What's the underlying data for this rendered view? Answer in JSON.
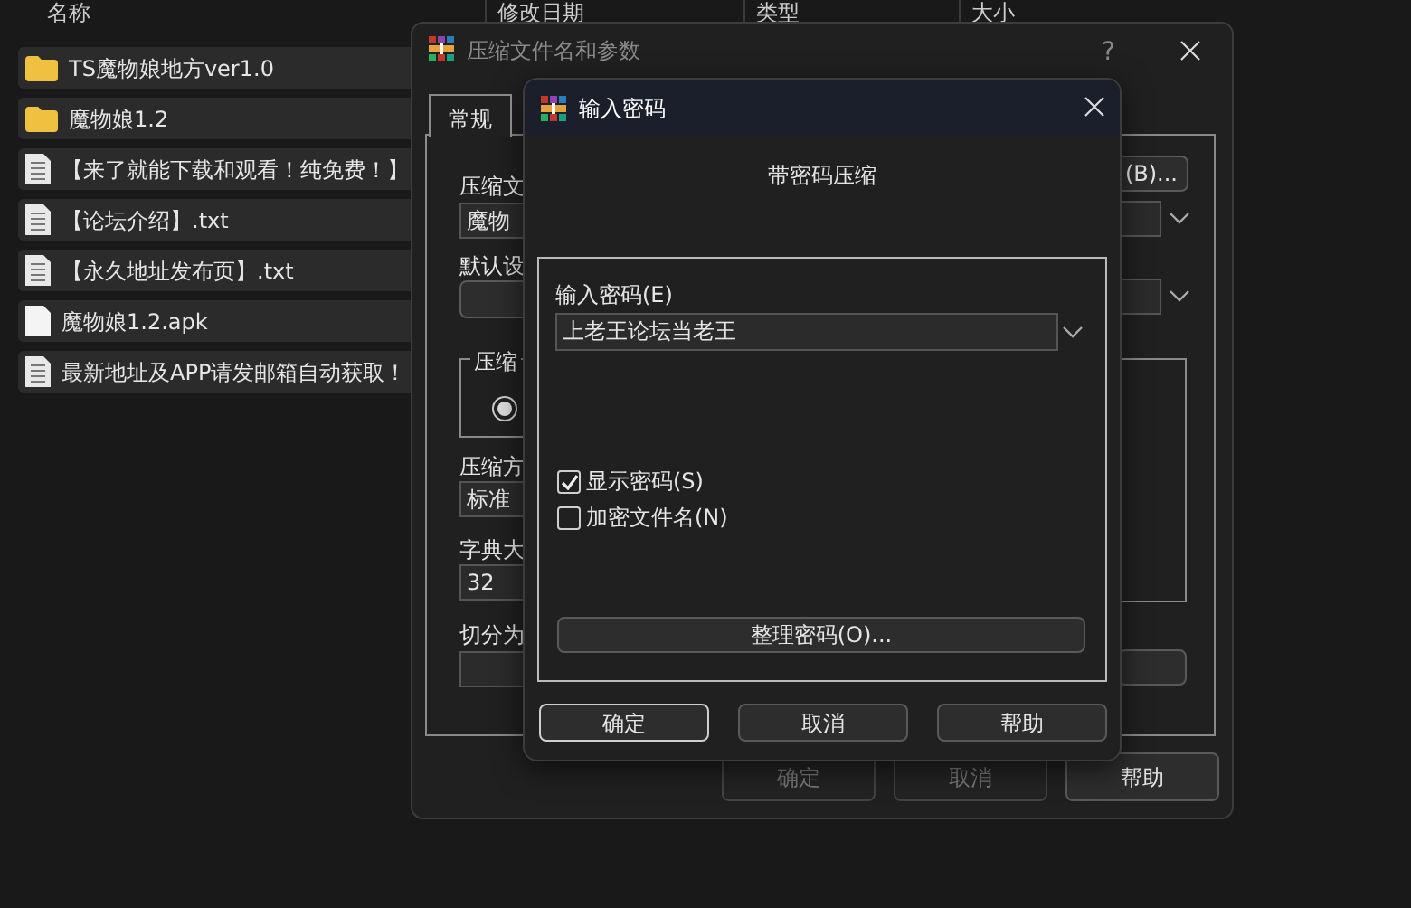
{
  "explorer": {
    "columns": [
      "名称",
      "修改日期",
      "类型",
      "大小"
    ],
    "files": [
      {
        "name": "TS魔物娘地方ver1.0",
        "kind": "folder"
      },
      {
        "name": "魔物娘1.2",
        "kind": "folder"
      },
      {
        "name": "【来了就能下载和观看！纯免费！】",
        "kind": "text"
      },
      {
        "name": "【论坛介绍】.txt",
        "kind": "text"
      },
      {
        "name": "【永久地址发布页】.txt",
        "kind": "text"
      },
      {
        "name": "魔物娘1.2.apk",
        "kind": "file"
      },
      {
        "name": "最新地址及APP请发邮箱自动获取！",
        "kind": "text"
      }
    ]
  },
  "main_dialog": {
    "title": "压缩文件名和参数",
    "help_button": "?",
    "tabs": [
      {
        "label": "常规",
        "selected": true
      }
    ],
    "general": {
      "archive_name_label": "压缩文",
      "archive_name": "魔物",
      "browse_button": "(B)...",
      "profile_label": "默认设",
      "format_group": "压缩",
      "format_radio_checked": true,
      "method_label": "压缩方",
      "method": "标准",
      "dictionary_label": "字典大",
      "dictionary": "32",
      "split_label": "切分为"
    },
    "buttons": [
      {
        "label": "确定",
        "disabled": true
      },
      {
        "label": "取消",
        "disabled": true
      },
      {
        "label": "帮助",
        "disabled": false
      }
    ]
  },
  "password_dialog": {
    "title": "输入密码",
    "heading": "带密码压缩",
    "password_label": "输入密码(E)",
    "password": "上老王论坛当老王",
    "options": [
      {
        "label": "显示密码(S)",
        "checked": true
      },
      {
        "label": "加密文件名(N)",
        "checked": false
      }
    ],
    "organize_button": "整理密码(O)...",
    "buttons": [
      {
        "label": "确定",
        "default": true
      },
      {
        "label": "取消",
        "default": false
      },
      {
        "label": "帮助",
        "default": false
      }
    ]
  }
}
